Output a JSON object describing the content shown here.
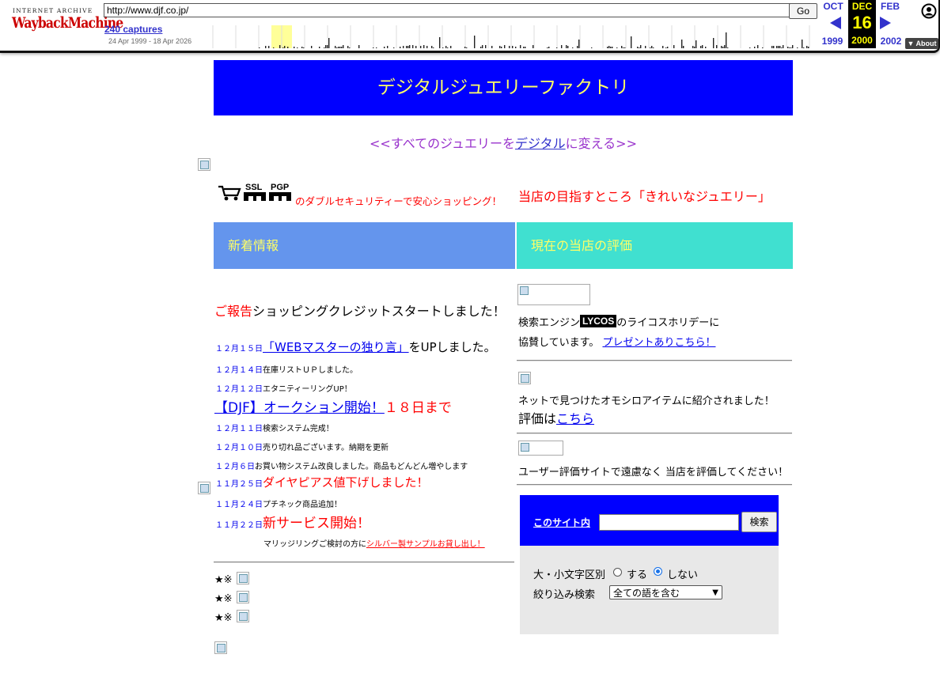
{
  "wayback": {
    "logo_top": "INTERNET ARCHIVE",
    "logo": "WaybackMachine",
    "url": "http://www.djf.co.jp/",
    "go_label": "Go",
    "captures": "240 captures",
    "range": "24 Apr 1999 - 18 Apr 2026",
    "prev_month": "OCT",
    "prev_year": "1999",
    "cur_month": "DEC",
    "cur_day": "16",
    "cur_year": "2000",
    "next_month": "FEB",
    "next_year": "2002",
    "about": "About",
    "colors": {
      "accent": "#3333cc",
      "highlight": "#ffff00",
      "current_bg": "#000000"
    }
  },
  "page": {
    "title": "デジタルジュエリーファクトリ",
    "tagline_pre": "<<すべてのジュエリーを",
    "tagline_link": "デジタル",
    "tagline_post": "に変える>>",
    "ssl": "SSL",
    "pgp": "PGP",
    "security_text": "のダブルセキュリティーで安心ショッピング！",
    "aim_text": "当店の目指すところ「きれいなジュエリー」",
    "news_header": "新着情報",
    "eval_header": "現在の当店の評価",
    "news": {
      "report_label": "ご報告",
      "report_text": "ショッピングクレジットスタートしました！",
      "items": [
        {
          "date": "１２月１５日",
          "link": "「WEBマスターの独り言」",
          "text": "をUPしました。"
        },
        {
          "date": "１２月１４日",
          "text": "在庫リストＵＰしました。"
        },
        {
          "date": "１２月１２日",
          "text": "エタニティーリングUP！"
        },
        {
          "link": "【DJF】オークション開始！",
          "text": "１８日まで"
        },
        {
          "date": "１２月１１日",
          "text": "検索システム完成！"
        },
        {
          "date": "１２月１０日",
          "text": "売り切れ品ございます。納期を更新"
        },
        {
          "date": "１２月６日",
          "text": "お買い物システム改良しました。商品もどんどん増やします"
        },
        {
          "date": "１１月２５日",
          "text": "ダイヤピアス値下げしました！"
        },
        {
          "date": "１１月２４日",
          "text": "プチネック商品追加！"
        },
        {
          "date": "１１月２２日",
          "text": "新サービス開始！"
        }
      ],
      "marriage_pre": "マリッジリングご検討の方に",
      "marriage_link": "シルバー製サンプルお貸し出し！",
      "stars": [
        "★※",
        "★※",
        "★※"
      ]
    },
    "eval": {
      "lycos_pre": "検索エンジン",
      "lycos_logo": "LYCOS",
      "lycos_post": "のライコスホリデーに",
      "lycos_line2": "協賛しています。",
      "lycos_link": "プレゼントありこちら！",
      "omoshiro": "ネットで見つけたオモシロアイテムに紹介されました！",
      "hyouka_pre": "評価は",
      "hyouka_link": "こちら",
      "user_eval": "ユーザー評価サイトで遠慮なく 当店を評価してください！"
    },
    "search": {
      "label": "このサイト内",
      "button": "検索",
      "case_label": "大・小文字区別",
      "opt_yes": "する",
      "opt_no": "しない",
      "filter_label": "絞り込み検索",
      "filter_value": "全ての語を含む"
    },
    "colors": {
      "banner": "#0000ff",
      "banner_text": "#ffff66",
      "news_head": "#6495ed",
      "eval_head": "#40e0d0",
      "alert": "#ff0000"
    }
  }
}
